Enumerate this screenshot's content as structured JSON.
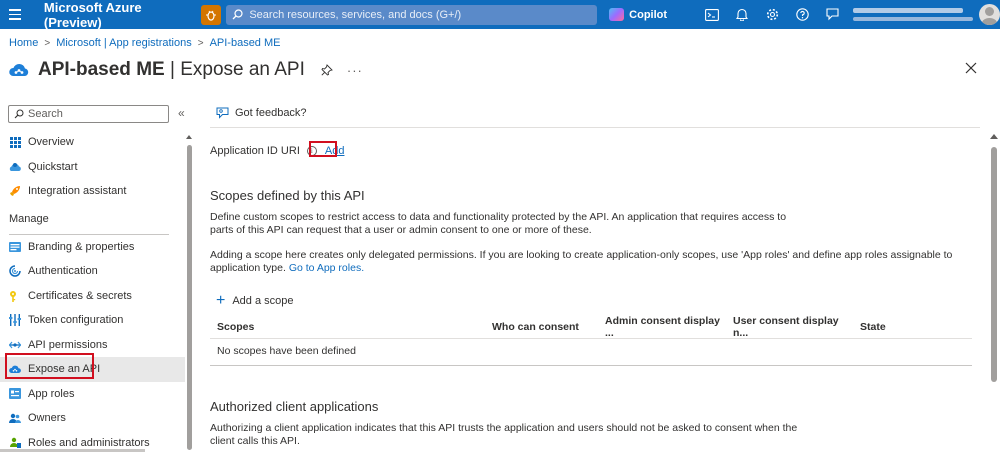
{
  "topbar": {
    "brand": "Microsoft Azure (Preview)",
    "search_placeholder": "Search resources, services, and docs (G+/)",
    "copilot_label": "Copilot",
    "icons": [
      "cloud-shell-icon",
      "bell-icon",
      "gear-icon",
      "help-icon",
      "feedback-icon"
    ],
    "accent_color": "#0f6cbd"
  },
  "breadcrumb": {
    "items": [
      "Home",
      "Microsoft | App registrations",
      "API-based ME"
    ]
  },
  "title": {
    "app_name": "API-based ME",
    "separator": "|",
    "page": "Expose an API",
    "more": "···"
  },
  "sidebar": {
    "search_placeholder": "Search",
    "collapse_glyph": "«",
    "top_items": [
      {
        "label": "Overview",
        "icon": "overview-icon"
      },
      {
        "label": "Quickstart",
        "icon": "quickstart-icon"
      },
      {
        "label": "Integration assistant",
        "icon": "rocket-icon"
      }
    ],
    "section_label": "Manage",
    "manage_items": [
      {
        "label": "Branding & properties",
        "icon": "branding-icon"
      },
      {
        "label": "Authentication",
        "icon": "authentication-icon"
      },
      {
        "label": "Certificates & secrets",
        "icon": "key-icon"
      },
      {
        "label": "Token configuration",
        "icon": "token-icon"
      },
      {
        "label": "API permissions",
        "icon": "api-permissions-icon"
      },
      {
        "label": "Expose an API",
        "icon": "cloud-icon",
        "active": true
      },
      {
        "label": "App roles",
        "icon": "app-roles-icon"
      },
      {
        "label": "Owners",
        "icon": "owners-icon"
      },
      {
        "label": "Roles and administrators",
        "icon": "roles-icon"
      }
    ]
  },
  "main": {
    "feedback_label": "Got feedback?",
    "app_id_label": "Application ID URI",
    "app_id_add": "Add",
    "scopes_heading": "Scopes defined by this API",
    "scopes_desc_1": "Define custom scopes to restrict access to data and functionality protected by the API. An application that requires access to parts of this API can request that a user or admin consent to one or more of these.",
    "scopes_desc_2": "Adding a scope here creates only delegated permissions. If you are looking to create application-only scopes, use 'App roles' and define app roles assignable to application type.",
    "scopes_desc_2_link": "Go to App roles.",
    "add_scope_label": "Add a scope",
    "table": {
      "columns": [
        "Scopes",
        "Who can consent",
        "Admin consent display ...",
        "User consent display n...",
        "State"
      ],
      "empty_message": "No scopes have been defined"
    },
    "clients_heading": "Authorized client applications",
    "clients_desc": "Authorizing a client application indicates that this API trusts the application and users should not be asked to consent when the client calls this API."
  }
}
